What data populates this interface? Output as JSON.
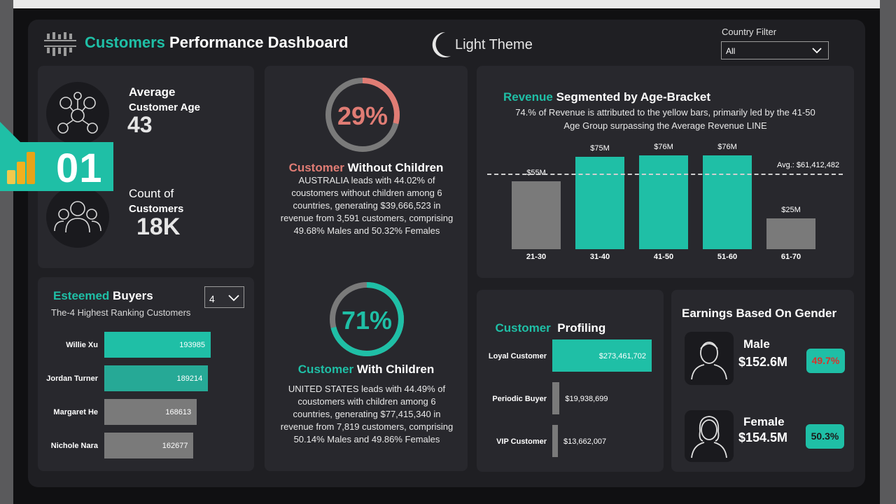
{
  "header": {
    "title_accent": "Customers",
    "title_rest": " Performance Dashboard",
    "theme_label": "Light Theme",
    "filter_label": "Country Filter",
    "filter_value": "All"
  },
  "badge": {
    "number": "01"
  },
  "kpis": {
    "avg_age_label_1": "Average",
    "avg_age_label_2": "Customer Age",
    "avg_age_value": "43",
    "count_label_1": "Count of",
    "count_label_2": "Customers",
    "count_value": "18K"
  },
  "buyers": {
    "title_accent": "Esteemed",
    "title_rest": " Buyers",
    "subtitle": "The-4 Highest Ranking Customers",
    "select_value": "4",
    "rows": [
      {
        "name": "Willie Xu",
        "value": 193985,
        "label": "193985",
        "color": "#1fbfa6"
      },
      {
        "name": "Jordan Turner",
        "value": 189214,
        "label": "189214",
        "color": "#26a996"
      },
      {
        "name": "Margaret He",
        "value": 168613,
        "label": "168613",
        "color": "#7a7a7a"
      },
      {
        "name": "Nichole Nara",
        "value": 162677,
        "label": "162677",
        "color": "#7a7a7a"
      }
    ]
  },
  "children": {
    "without_pct": 29,
    "without_pct_label": "29%",
    "without_title_accent": "Customer",
    "without_title_rest": " Without Children",
    "without_text": "AUSTRALIA leads with 44.02% of coustomers without children among 6 countries, generating $39,666,523 in revenue from 3,591 customers, comprising 49.68% Males and 50.32% Females",
    "with_pct": 71,
    "with_pct_label": "71%",
    "with_title_accent": "Customer",
    "with_title_rest": " With Children",
    "with_text": "UNITED STATES leads with 44.49% of coustomers with children among 6 countries, generating $77,415,340 in revenue from 7,819 customers, comprising 50.14% Males and 49.86% Females"
  },
  "revenue": {
    "title_accent": "Revenue",
    "title_rest": " Segmented by Age-Bracket",
    "subtitle_1": "74.% of Revenue is attributed to the yellow bars, primarily led by the 41-50",
    "subtitle_2": "Age Group surpassing the Average Revenue LINE",
    "avg_label": "Avg.: $61,412,482"
  },
  "chart_data": {
    "type": "bar",
    "categories": [
      "21-30",
      "31-40",
      "41-50",
      "51-60",
      "61-70"
    ],
    "values": [
      55,
      75,
      76,
      76,
      25
    ],
    "value_labels": [
      "$55M",
      "$75M",
      "$76M",
      "$76M",
      "$25M"
    ],
    "colors": [
      "#7a7a7a",
      "#1fbfa6",
      "#1fbfa6",
      "#1fbfa6",
      "#7a7a7a"
    ],
    "average": 61.412482,
    "ylim": [
      0,
      85
    ]
  },
  "profiling": {
    "title_accent": "Customer",
    "title_rest": "  Profiling",
    "rows": [
      {
        "name": "Loyal Customer",
        "value": 273461702,
        "label": "$273,461,702",
        "color": "#1fbfa6"
      },
      {
        "name": "Periodic Buyer",
        "value": 19938699,
        "label": "$19,938,699",
        "color": "#7a7a7a"
      },
      {
        "name": "VIP Customer",
        "value": 13662007,
        "label": "$13,662,007",
        "color": "#7a7a7a"
      }
    ]
  },
  "gender": {
    "title_accent": "Earnings",
    "title_rest": " Based On Gender",
    "male_label": "Male",
    "male_value": "$152.6M",
    "male_pct": "49.7%",
    "female_label": "Female",
    "female_value": "$154.5M",
    "female_pct": "50.3%"
  }
}
